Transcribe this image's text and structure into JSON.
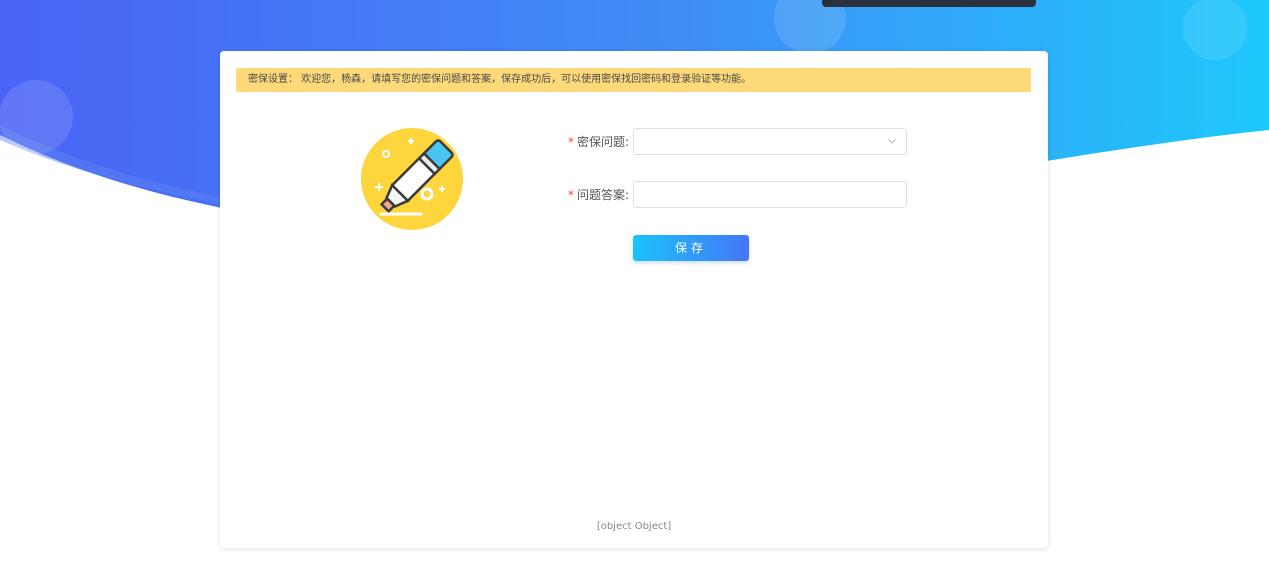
{
  "notice": {
    "text": "密保设置： 欢迎您，杨森，请填写您的密保问题和答案，保存成功后，可以使用密保找回密码和登录验证等功能。"
  },
  "form": {
    "required_mark": "*",
    "question_label": "密保问题:",
    "question_value": "",
    "answer_label": "问题答案:",
    "answer_value": "",
    "save_label": "保存"
  },
  "footer": {
    "text": "[object Object]"
  },
  "colors": {
    "hero_left": "#4a63f5",
    "hero_right": "#1ec8fb",
    "notice_bg": "#fdd97a",
    "button_start": "#1bc3fb",
    "button_end": "#4476f6",
    "illustration_circle": "#fdd53c",
    "required": "#f04b4b"
  },
  "icons": {
    "illustration": "marker-pen-icon",
    "dropdown": "chevron-down-icon"
  }
}
